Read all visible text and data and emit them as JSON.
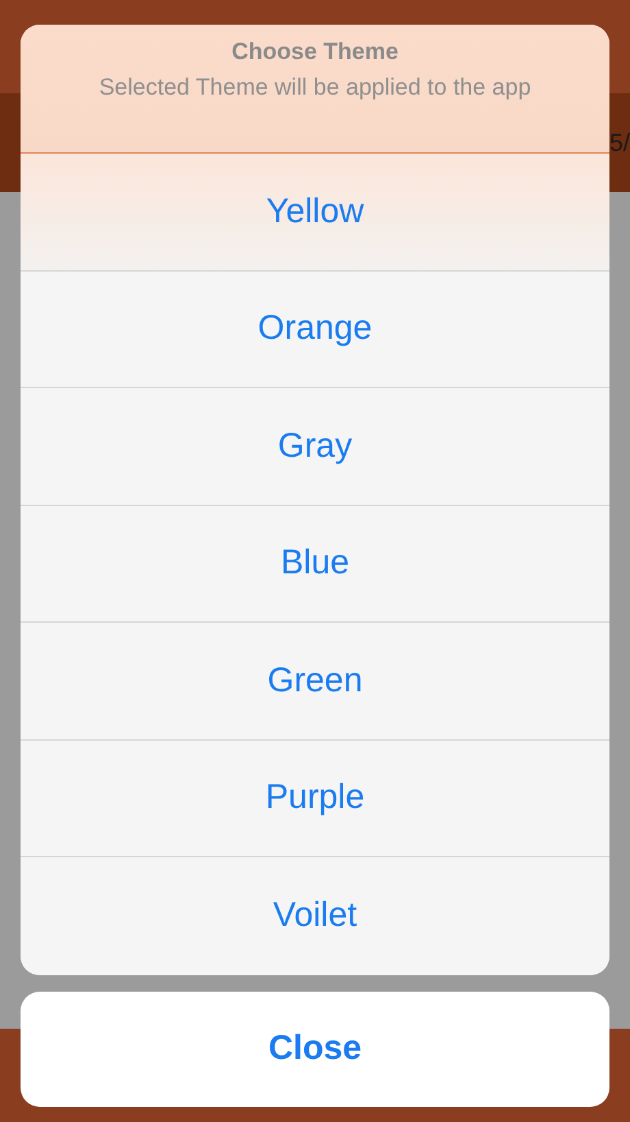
{
  "background": {
    "header_fragment": "5/"
  },
  "action_sheet": {
    "title": "Choose Theme",
    "message": "Selected Theme will be applied to the app",
    "options": [
      {
        "label": "Yellow"
      },
      {
        "label": "Orange"
      },
      {
        "label": "Gray"
      },
      {
        "label": "Blue"
      },
      {
        "label": "Green"
      },
      {
        "label": "Purple"
      },
      {
        "label": "Voilet"
      }
    ],
    "cancel": "Close"
  }
}
